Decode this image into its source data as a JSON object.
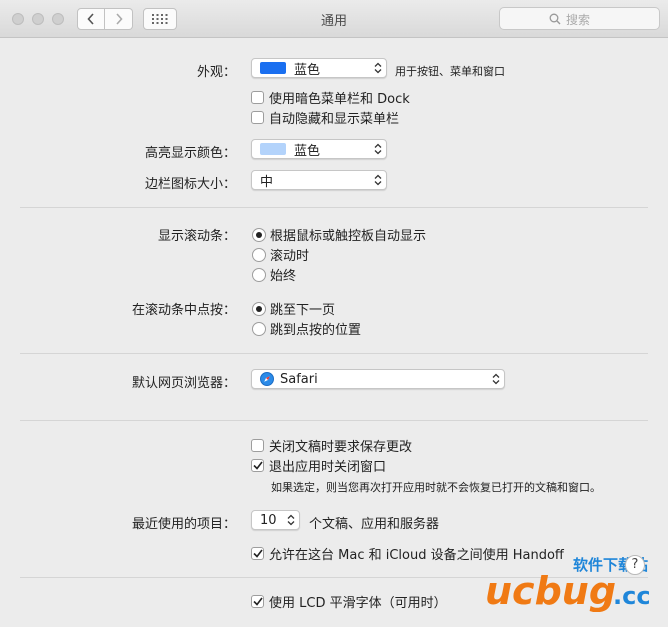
{
  "window": {
    "title": "通用",
    "search_placeholder": "搜索"
  },
  "appearance": {
    "label": "外观：",
    "value": "蓝色",
    "swatch_color": "#1a6ff0",
    "note": "用于按钮、菜单和窗口",
    "dark_menu": {
      "label": "使用暗色菜单栏和 Dock",
      "checked": false
    },
    "auto_hide_menu": {
      "label": "自动隐藏和显示菜单栏",
      "checked": false
    }
  },
  "highlight": {
    "label": "高亮显示颜色：",
    "value": "蓝色",
    "swatch_color": "#b3d3fb"
  },
  "sidebar_icon_size": {
    "label": "边栏图标大小：",
    "value": "中"
  },
  "scrollbars": {
    "label": "显示滚动条：",
    "options": [
      "根据鼠标或触控板自动显示",
      "滚动时",
      "始终"
    ],
    "selected": 0
  },
  "click_scrollbar": {
    "label": "在滚动条中点按：",
    "options": [
      "跳至下一页",
      "跳到点按的位置"
    ],
    "selected": 0
  },
  "browser": {
    "label": "默认网页浏览器：",
    "value": "Safari"
  },
  "documents": {
    "ask_save": {
      "label": "关闭文稿时要求保存更改",
      "checked": false
    },
    "close_windows": {
      "label": "退出应用时关闭窗口",
      "checked": true
    },
    "note": "如果选定，则当您再次打开应用时就不会恢复已打开的文稿和窗口。"
  },
  "recent_items": {
    "label": "最近使用的项目：",
    "value": "10",
    "suffix": "个文稿、应用和服务器"
  },
  "handoff": {
    "label": "允许在这台 Mac 和 iCloud 设备之间使用 Handoff",
    "checked": true
  },
  "lcd": {
    "label": "使用 LCD 平滑字体（可用时）",
    "checked": true
  },
  "help_label": "?",
  "watermark": "软件下载站 ucbug.cc"
}
